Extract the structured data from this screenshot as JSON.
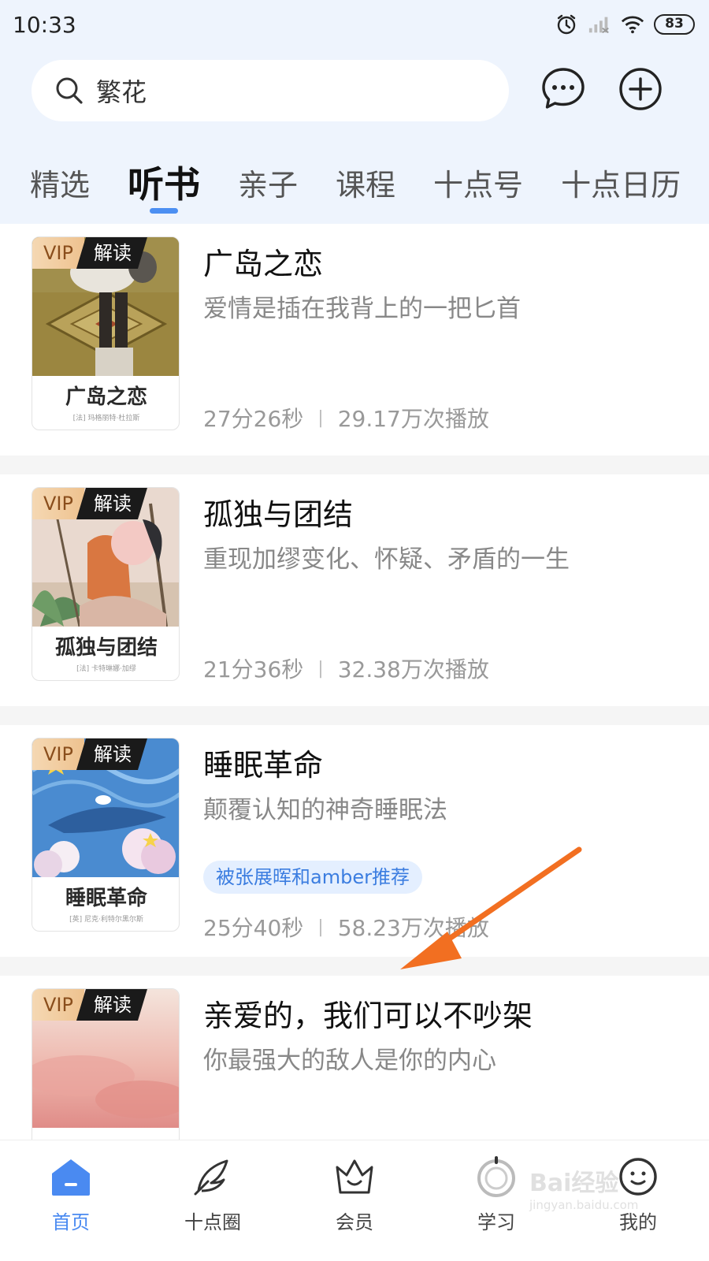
{
  "status_bar": {
    "time": "10:33",
    "battery": "83"
  },
  "search": {
    "text": "繁花"
  },
  "tabs": [
    {
      "label": "精选",
      "active": false
    },
    {
      "label": "听书",
      "active": true
    },
    {
      "label": "亲子",
      "active": false
    },
    {
      "label": "课程",
      "active": false
    },
    {
      "label": "十点号",
      "active": false
    },
    {
      "label": "十点日历",
      "active": false
    }
  ],
  "badges": {
    "vip": "VIP",
    "type": "解读"
  },
  "books": [
    {
      "title": "广岛之恋",
      "subtitle": "爱情是插在我背上的一把匕首",
      "duration": "27分26秒",
      "plays": "29.17万次播放",
      "cover_title": "广岛之恋",
      "cover_author": "[法] 玛格丽特·杜拉斯"
    },
    {
      "title": "孤独与团结",
      "subtitle": "重现加缪变化、怀疑、矛盾的一生",
      "duration": "21分36秒",
      "plays": "32.38万次播放",
      "cover_title": "孤独与团结",
      "cover_author": "[法] 卡特琳娜·加缪"
    },
    {
      "title": "睡眠革命",
      "subtitle": "颠覆认知的神奇睡眠法",
      "recommend": "被张展晖和amber推荐",
      "duration": "25分40秒",
      "plays": "58.23万次播放",
      "cover_title": "睡眠革命",
      "cover_author": "[英] 尼克·利特尔黑尔斯"
    },
    {
      "title": "亲爱的，我们可以不吵架",
      "subtitle": "你最强大的敌人是你的内心"
    }
  ],
  "meta_separator": "|",
  "bottom_nav": [
    {
      "label": "首页",
      "icon": "home-icon",
      "active": true
    },
    {
      "label": "十点圈",
      "icon": "feather-icon",
      "active": false
    },
    {
      "label": "会员",
      "icon": "crown-icon",
      "active": false
    },
    {
      "label": "学习",
      "icon": "study-icon",
      "active": false
    },
    {
      "label": "我的",
      "icon": "profile-icon",
      "active": false
    }
  ],
  "watermark": {
    "text": "Bai经验",
    "sub": "jingyan.baidu.com"
  },
  "colors": {
    "accent": "#4a8af1",
    "header_bg": "#eef4fd",
    "arrow": "#f26f21",
    "tag_bg": "#e4efff",
    "tag_text": "#3b7de0"
  }
}
